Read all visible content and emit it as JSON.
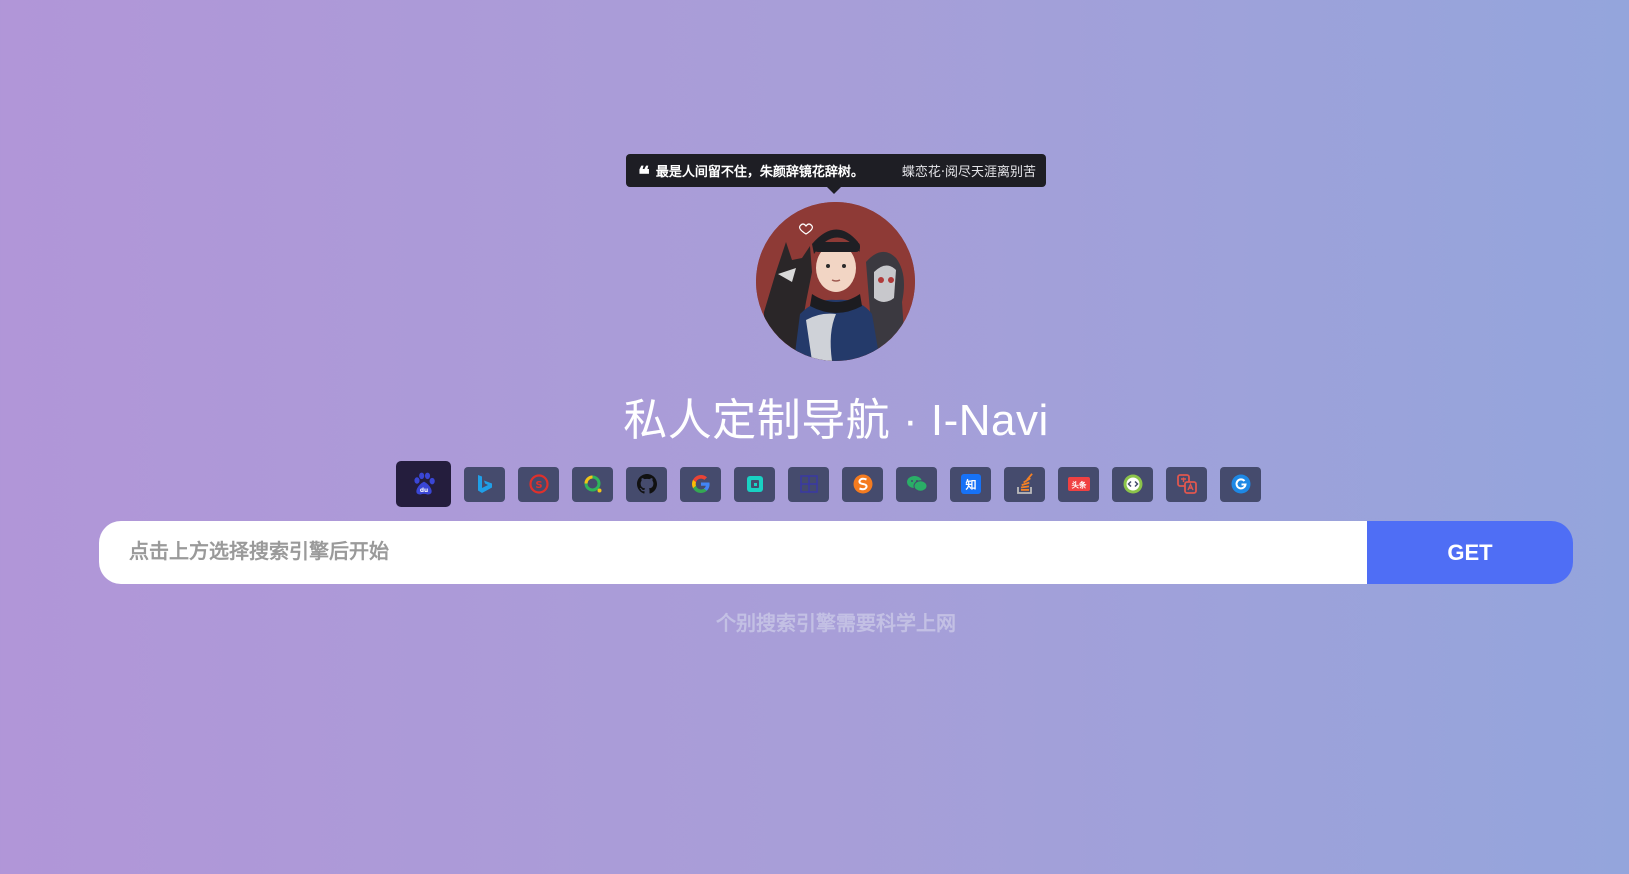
{
  "quote": {
    "text": "最是人间留不住，朱颜辞镜花辞树。",
    "source": "蝶恋花·阅尽天涯离别苦",
    "icon": "quote-icon"
  },
  "title": "私人定制导航 · I-Navi",
  "engines": [
    {
      "name": "baidu",
      "icon": "paw-icon",
      "color": "#3a46d6",
      "active": true
    },
    {
      "name": "bing",
      "icon": "bing-icon",
      "color": "#1f9fe8"
    },
    {
      "name": "sogou",
      "icon": "sogou-icon",
      "color": "#e0302b"
    },
    {
      "name": "360",
      "icon": "so360-icon",
      "color": "#2fb45a"
    },
    {
      "name": "github",
      "icon": "github-icon",
      "color": "#111111"
    },
    {
      "name": "google",
      "icon": "google-icon",
      "color": "#4285f4"
    },
    {
      "name": "dev",
      "icon": "square-icon",
      "color": "#19d1c3"
    },
    {
      "name": "grid",
      "icon": "grid-icon",
      "color": "#3a3aa0"
    },
    {
      "name": "s",
      "icon": "s-circle-icon",
      "color": "#f47b20"
    },
    {
      "name": "wechat",
      "icon": "wechat-icon",
      "color": "#2aae67"
    },
    {
      "name": "zhihu",
      "icon": "zhihu-icon",
      "color": "#1772f6"
    },
    {
      "name": "stackoverflow",
      "icon": "stack-icon",
      "color": "#f48024"
    },
    {
      "name": "toutiao",
      "icon": "toutiao-icon",
      "color": "#f04142",
      "label": "头条"
    },
    {
      "name": "code",
      "icon": "code-circle-icon",
      "color": "#8bc34a"
    },
    {
      "name": "translate",
      "icon": "translate-icon",
      "color": "#e0574f"
    },
    {
      "name": "g",
      "icon": "g-circle-icon",
      "color": "#1e88e5"
    }
  ],
  "search": {
    "placeholder": "点击上方选择搜索引擎后开始",
    "button_label": "GET"
  },
  "hint": "个别搜索引擎需要科学上网",
  "colors": {
    "accent": "#4f6ef5",
    "engine_bg": "#454b6d",
    "engine_active_bg": "#241d3d"
  }
}
